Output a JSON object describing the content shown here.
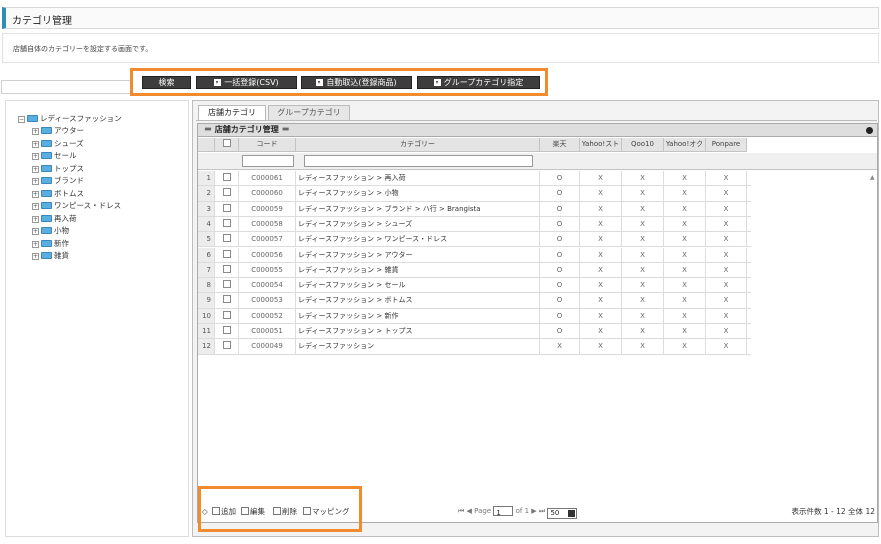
{
  "page_title": "カテゴリ管理",
  "description": "店舗自体のカテゴリーを設定する画面です。",
  "toolbar": {
    "search_label": "検索",
    "bulk_register_label": "一括登録(CSV)",
    "auto_import_label": "自動取込(登録商品)",
    "group_category_label": "グループカテゴリ指定"
  },
  "tree": {
    "root": "レディースファッション",
    "children": [
      "アウター",
      "シューズ",
      "セール",
      "トップス",
      "ブランド",
      "ボトムス",
      "ワンピース・ドレス",
      "再入荷",
      "小物",
      "新作",
      "雑貨"
    ]
  },
  "tabs": [
    "店舗カテゴリ",
    "グループカテゴリ"
  ],
  "grid": {
    "title": "店舗カテゴリ管理",
    "columns": [
      "コード",
      "カテゴリー",
      "楽天",
      "Yahoo!スト",
      "Qoo10",
      "Yahoo!オク",
      "Ponpare"
    ],
    "rows": [
      {
        "n": "1",
        "code": "C000061",
        "category": "レディースファッション > 再入荷",
        "rakuten": "O",
        "ys": "X",
        "qoo": "X",
        "yo": "X",
        "pon": "X"
      },
      {
        "n": "2",
        "code": "C000060",
        "category": "レディースファッション > 小物",
        "rakuten": "O",
        "ys": "X",
        "qoo": "X",
        "yo": "X",
        "pon": "X"
      },
      {
        "n": "3",
        "code": "C000059",
        "category": "レディースファッション > ブランド > ハ行 > Brangista",
        "rakuten": "O",
        "ys": "X",
        "qoo": "X",
        "yo": "X",
        "pon": "X"
      },
      {
        "n": "4",
        "code": "C000058",
        "category": "レディースファッション > シューズ",
        "rakuten": "O",
        "ys": "X",
        "qoo": "X",
        "yo": "X",
        "pon": "X"
      },
      {
        "n": "5",
        "code": "C000057",
        "category": "レディースファッション > ワンピース・ドレス",
        "rakuten": "O",
        "ys": "X",
        "qoo": "X",
        "yo": "X",
        "pon": "X"
      },
      {
        "n": "6",
        "code": "C000056",
        "category": "レディースファッション > アウター",
        "rakuten": "O",
        "ys": "X",
        "qoo": "X",
        "yo": "X",
        "pon": "X"
      },
      {
        "n": "7",
        "code": "C000055",
        "category": "レディースファッション > 雑貨",
        "rakuten": "O",
        "ys": "X",
        "qoo": "X",
        "yo": "X",
        "pon": "X"
      },
      {
        "n": "8",
        "code": "C000054",
        "category": "レディースファッション > セール",
        "rakuten": "O",
        "ys": "X",
        "qoo": "X",
        "yo": "X",
        "pon": "X"
      },
      {
        "n": "9",
        "code": "C000053",
        "category": "レディースファッション > ボトムス",
        "rakuten": "O",
        "ys": "X",
        "qoo": "X",
        "yo": "X",
        "pon": "X"
      },
      {
        "n": "10",
        "code": "C000052",
        "category": "レディースファッション > 新作",
        "rakuten": "O",
        "ys": "X",
        "qoo": "X",
        "yo": "X",
        "pon": "X"
      },
      {
        "n": "11",
        "code": "C000051",
        "category": "レディースファッション > トップス",
        "rakuten": "O",
        "ys": "X",
        "qoo": "X",
        "yo": "X",
        "pon": "X"
      },
      {
        "n": "12",
        "code": "C000049",
        "category": "レディースファッション",
        "rakuten": "X",
        "ys": "X",
        "qoo": "X",
        "yo": "X",
        "pon": "X"
      }
    ]
  },
  "footer": {
    "add_label": "追加",
    "edit_label": "編集",
    "delete_label": "削除",
    "mapping_label": "マッピング",
    "page_label": "Page",
    "page_value": "1",
    "of_label": "of 1",
    "page_size": "50",
    "count_text": "表示件数 1 - 12 全体 12"
  }
}
